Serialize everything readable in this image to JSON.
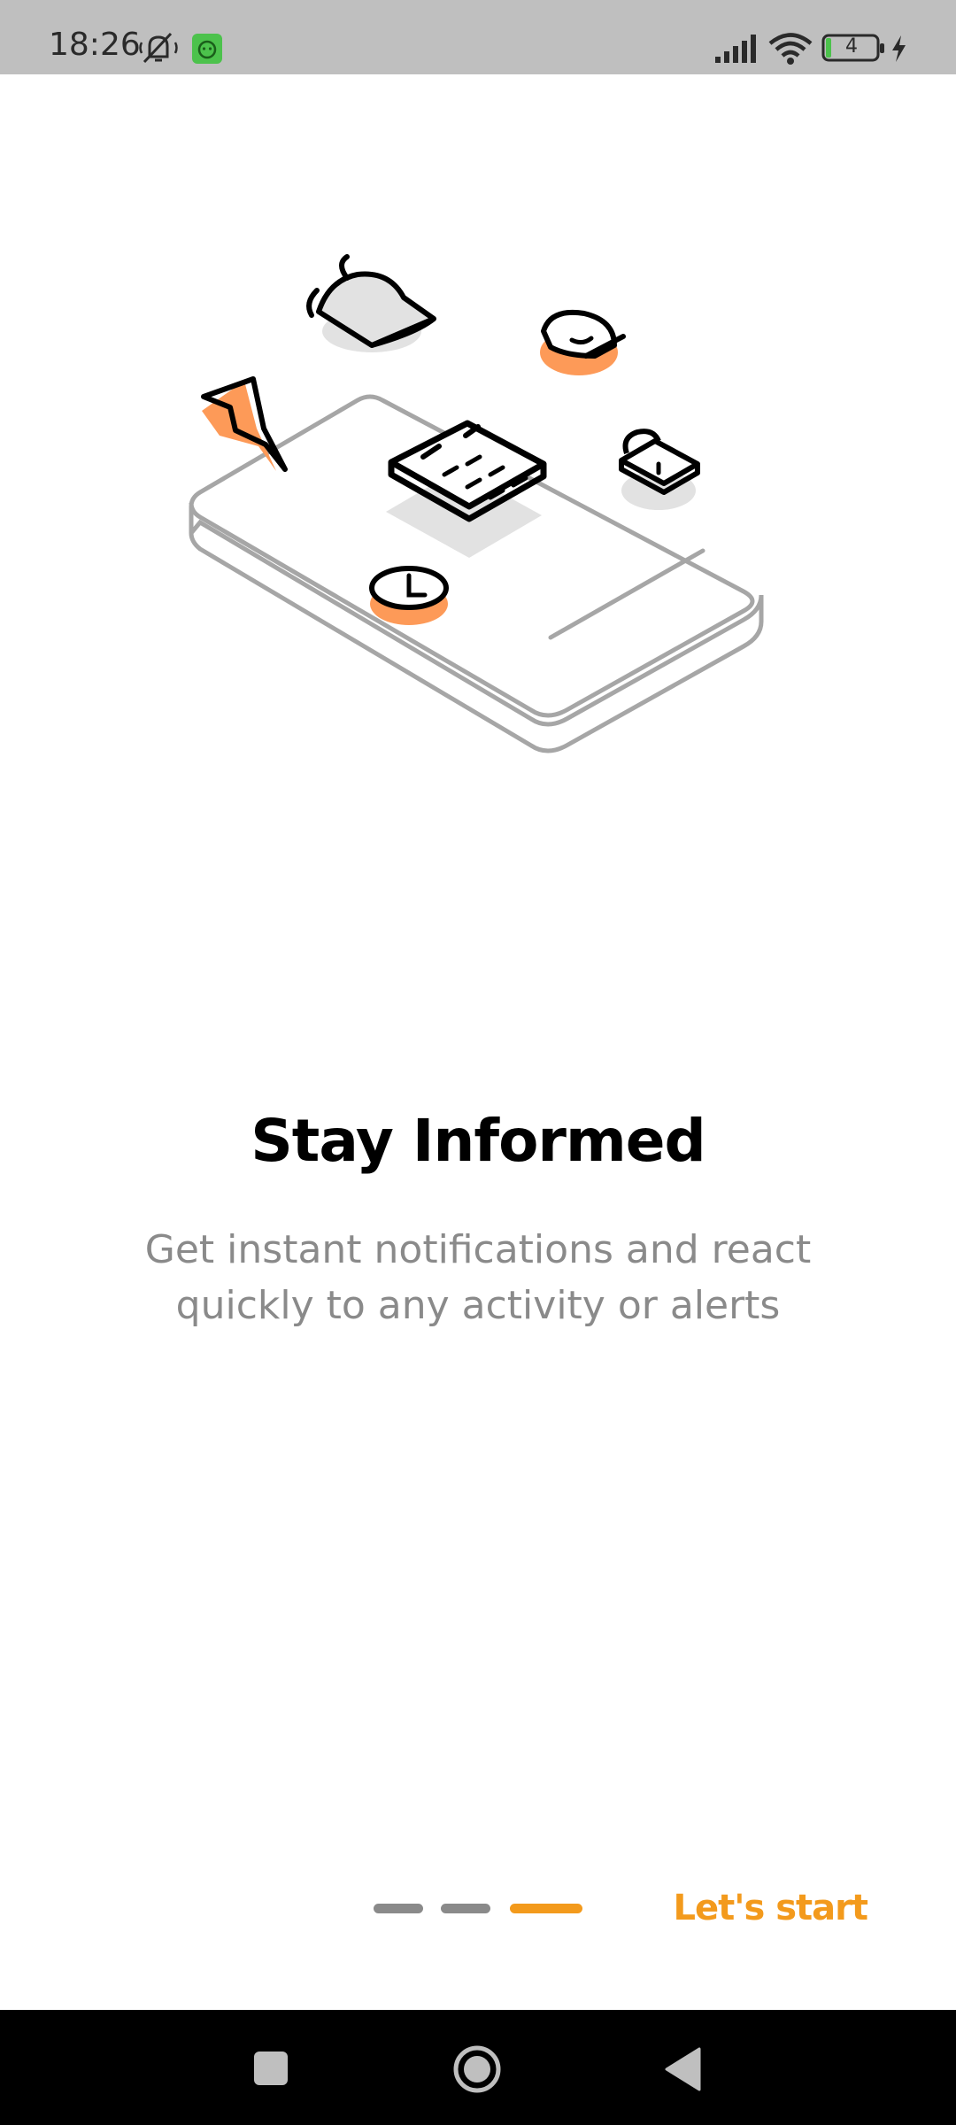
{
  "status_bar": {
    "time": "18:26",
    "battery_level": "4",
    "icons": [
      "do-not-disturb-icon",
      "app-notification-icon",
      "signal-icon",
      "wifi-icon",
      "battery-icon",
      "charging-icon"
    ]
  },
  "onboarding": {
    "title": "Stay Informed",
    "subtitle": "Get instant notifications and react quickly to any activity or alerts",
    "page_index": 3,
    "page_count": 3,
    "start_label": "Let's start",
    "accent_color": "#f39a1c"
  },
  "nav_bar": {
    "icons": [
      "recent-apps-icon",
      "home-icon",
      "back-icon"
    ]
  }
}
